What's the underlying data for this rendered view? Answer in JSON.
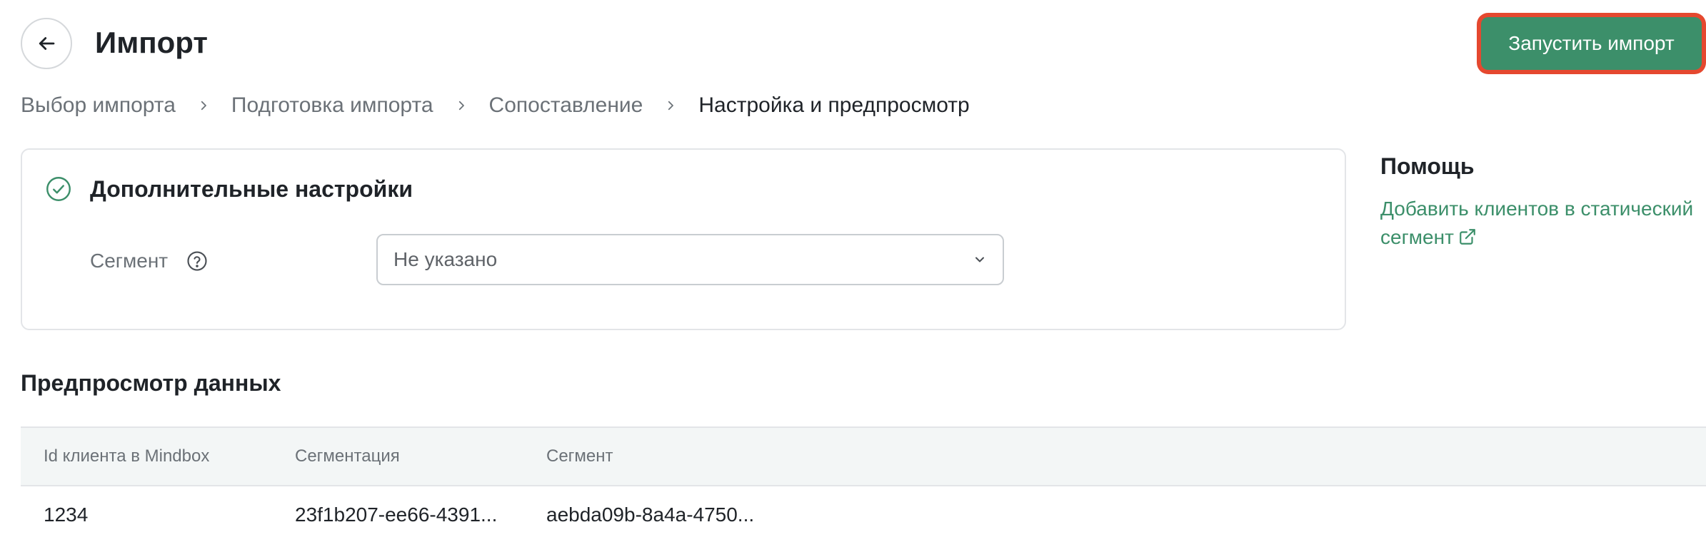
{
  "header": {
    "title": "Импорт",
    "run_button": "Запустить импорт"
  },
  "breadcrumb": [
    {
      "label": "Выбор импорта"
    },
    {
      "label": "Подготовка импорта"
    },
    {
      "label": "Сопоставление"
    },
    {
      "label": "Настройка и предпросмотр"
    }
  ],
  "settings": {
    "title": "Дополнительные настройки",
    "segment_label": "Сегмент",
    "segment_value": "Не указано"
  },
  "help": {
    "title": "Помощь",
    "link_line1": "Добавить клиентов в статический",
    "link_line2": "сегмент"
  },
  "preview": {
    "title": "Предпросмотр данных",
    "columns": [
      "Id клиента в Mindbox",
      "Сегментация",
      "Сегмент"
    ],
    "rows": [
      [
        "1234",
        "23f1b207-ee66-4391...",
        "aebda09b-8a4a-4750..."
      ]
    ]
  },
  "colors": {
    "accent": "#3c8f6a",
    "highlight": "#e5482f"
  },
  "icons": {
    "back": "arrow-left-icon",
    "check": "check-circle-icon",
    "help": "question-circle-icon",
    "dropdown": "chevron-down-icon",
    "external": "external-link-icon"
  }
}
